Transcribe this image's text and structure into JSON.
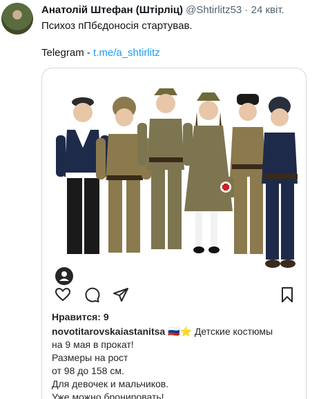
{
  "tweet": {
    "author_name": "Анатолій Штефан (Штірліц)",
    "handle": "@Shtirlitz53",
    "separator": "·",
    "date": "24 квіт.",
    "text": "Психоз пПбєдоносія стартував.",
    "telegram_label": "Telegram - ",
    "telegram_link": "t.me/a_shtirlitz"
  },
  "embedded_post": {
    "likes": "Нравится: 9",
    "username": "novotitarovskaiastanitsa",
    "caption_first": "🇷🇺⭐ Детские костюмы",
    "caption_lines": [
      "на 9 мая в прокат!",
      "Размеры на рост",
      "от 98 до 158 см.",
      "Для девочек и мальчиков.",
      "Уже можно бронировать!"
    ],
    "icons": [
      "heart-icon",
      "comment-icon",
      "share-icon",
      "bookmark-icon",
      "user-tag-icon"
    ]
  },
  "colors": {
    "link": "#1d9bf0",
    "meta": "#536471",
    "card_border": "#cfd9de",
    "uniform_khaki": "#8b7a4e",
    "navy": "#1e2a4a"
  }
}
